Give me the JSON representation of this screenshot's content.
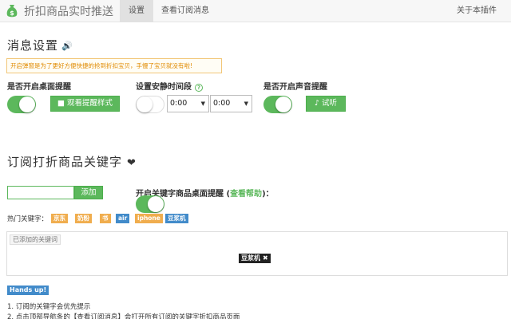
{
  "navbar": {
    "brand": "折扣商品实时推送",
    "tabs": [
      "设置",
      "查看订阅消息"
    ],
    "right": "关于本插件"
  },
  "notify": {
    "title": "消息设置",
    "tip": "开启弹窗是为了更好方便快捷的抢到折扣宝贝，手慢了宝贝就没有啦!",
    "desktop_label": "是否开启桌面提醒",
    "desktop_on": true,
    "preview_button": "观看提醒样式",
    "quiet_label": "设置安静时间段",
    "quiet_on": false,
    "quiet_from": "0:00",
    "quiet_to": "0:00",
    "sound_label": "是否开启声音提醒",
    "sound_on": true,
    "sound_button": "试听"
  },
  "subscribe": {
    "title": "订阅打折商品关键字",
    "input_value": "",
    "add_button": "添加",
    "keyword_alert_label": "开启关键字商品桌面提醒",
    "keyword_alert_help_open": "(",
    "keyword_alert_help": "查看帮助",
    "keyword_alert_help_close": ")：",
    "keyword_alert_on": true,
    "hot_label": "热门关键字：",
    "hot_keywords": [
      {
        "text": "京东",
        "color": "orange"
      },
      {
        "text": "奶粉",
        "color": "orange"
      },
      {
        "text": "书",
        "color": "orange"
      },
      {
        "text": "air",
        "color": "blue"
      },
      {
        "text": "iphone",
        "color": "orange"
      },
      {
        "text": "豆浆机",
        "color": "blue"
      }
    ],
    "added_title": "已添加的关键词",
    "added_keywords": [
      "豆浆机"
    ]
  },
  "notes": {
    "badge": "Hands up!",
    "items": [
      "1. 订阅的关键字会优先提示",
      "2. 点击顶部导航条的【查看订阅消息】会打开所有订阅的关键字折扣商品页面"
    ]
  },
  "colors": {
    "green": "#5cb85c",
    "orange": "#f0ad4e",
    "blue": "#428bca",
    "tip_text": "#e08a00"
  }
}
